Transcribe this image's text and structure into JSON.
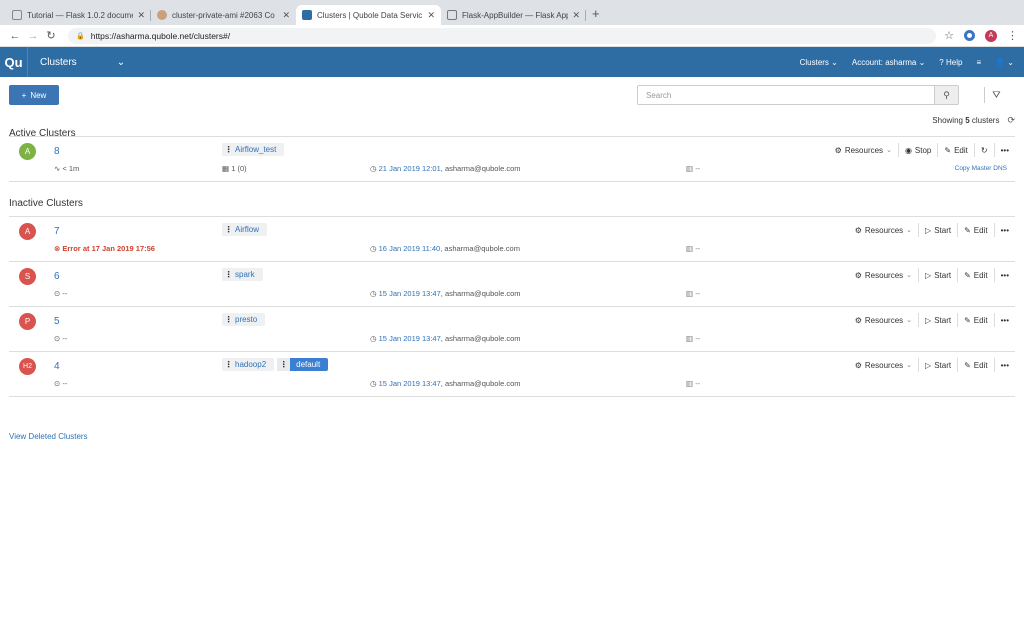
{
  "browser": {
    "tabs": [
      {
        "title": "Tutorial — Flask 1.0.2 documen",
        "active": false
      },
      {
        "title": "cluster-private-ami #2063 Co",
        "active": false
      },
      {
        "title": "Clusters | Qubole Data Servic",
        "active": true
      },
      {
        "title": "Flask-AppBuilder — Flask App",
        "active": false
      }
    ],
    "url": "https://asharma.qubole.net/clusters#/",
    "profile_initial": "A"
  },
  "appbar": {
    "logo": "Qu",
    "title": "Clusters",
    "menu_clusters": "Clusters",
    "menu_account": "Account: asharma",
    "menu_help": "Help"
  },
  "toolbar": {
    "new_label": "New",
    "search_placeholder": "Search",
    "showing_prefix": "Showing ",
    "showing_count": "5",
    "showing_suffix": " clusters"
  },
  "active_section": {
    "title": "Active Clusters",
    "clusters": [
      {
        "badge": "A",
        "badge_color": "#7cb342",
        "id": "8",
        "status": "< 1m",
        "label": "Airflow_test",
        "nodes": "1 (0)",
        "date": "21 Jan 2019 12:01",
        "user": ", asharma@qubole.com",
        "ec2": "--",
        "actions": [
          "Resources",
          "Stop",
          "Edit"
        ],
        "copy_dns": "Copy Master DNS"
      }
    ]
  },
  "inactive_section": {
    "title": "Inactive Clusters",
    "clusters": [
      {
        "badge": "A",
        "badge_color": "#d9534f",
        "id": "7",
        "status": "Error at 17 Jan 2019 17:56",
        "error": true,
        "labels": [
          "Airflow"
        ],
        "date": "16 Jan 2019 11:40",
        "user": ", asharma@qubole.com",
        "ec2": "--",
        "actions": [
          "Resources",
          "Start",
          "Edit"
        ]
      },
      {
        "badge": "S",
        "badge_color": "#d9534f",
        "id": "6",
        "status": "--",
        "labels": [
          "spark"
        ],
        "date": "15 Jan 2019 13:47",
        "user": ", asharma@qubole.com",
        "ec2": "--",
        "actions": [
          "Resources",
          "Start",
          "Edit"
        ]
      },
      {
        "badge": "P",
        "badge_color": "#d9534f",
        "id": "5",
        "status": "--",
        "labels": [
          "presto"
        ],
        "date": "15 Jan 2019 13:47",
        "user": ", asharma@qubole.com",
        "ec2": "--",
        "actions": [
          "Resources",
          "Start",
          "Edit"
        ]
      },
      {
        "badge": "H2",
        "badge_color": "#d9534f",
        "id": "4",
        "status": "--",
        "labels": [
          "hadoop2",
          "default"
        ],
        "date": "15 Jan 2019 13:47",
        "user": ", asharma@qubole.com",
        "ec2": "--",
        "actions": [
          "Resources",
          "Start",
          "Edit"
        ]
      }
    ]
  },
  "footer": {
    "view_deleted": "View Deleted Clusters"
  }
}
